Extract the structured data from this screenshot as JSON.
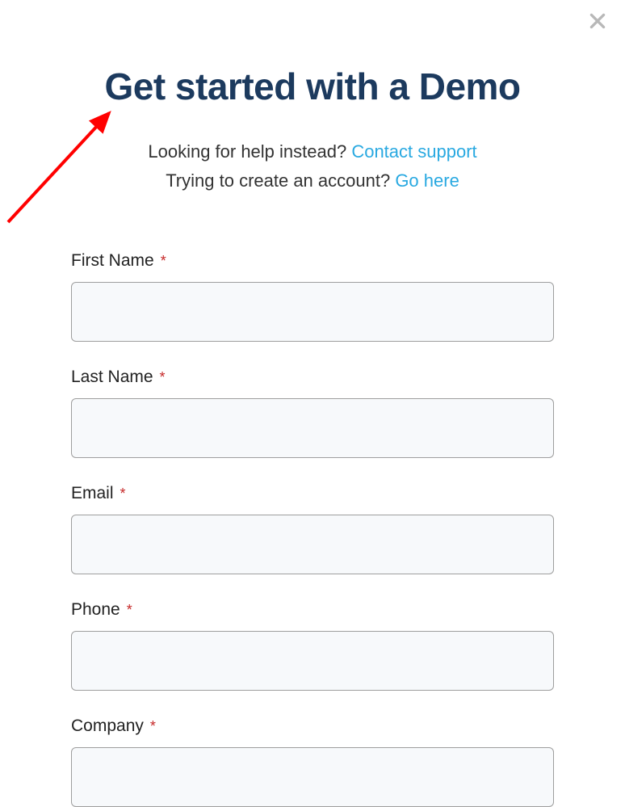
{
  "modal": {
    "title": "Get started with a Demo",
    "subtitle1_text": "Looking for help instead? ",
    "subtitle1_link": "Contact support",
    "subtitle2_text": "Trying to create an account? ",
    "subtitle2_link": "Go here"
  },
  "form": {
    "fields": [
      {
        "label": "First Name",
        "required": true,
        "value": ""
      },
      {
        "label": "Last Name",
        "required": true,
        "value": ""
      },
      {
        "label": "Email",
        "required": true,
        "value": ""
      },
      {
        "label": "Phone",
        "required": true,
        "value": ""
      },
      {
        "label": "Company",
        "required": true,
        "value": ""
      }
    ],
    "required_marker": "*"
  }
}
